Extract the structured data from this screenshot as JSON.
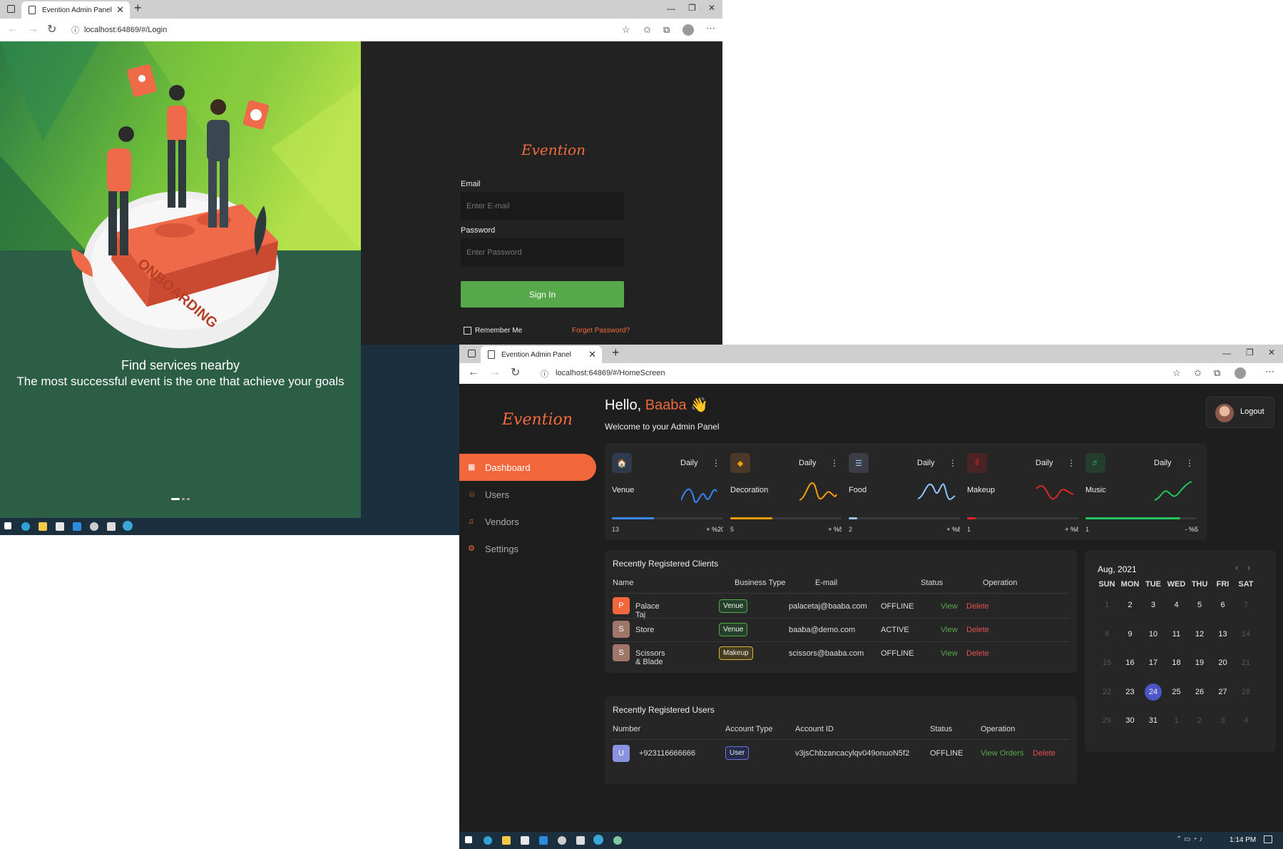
{
  "login_window": {
    "tab_title": "Evention Admin Panel",
    "url": "localhost:64869/#/Login",
    "illustration": {
      "headline": "Find services nearby",
      "subline": "The most successful event is the one that achieve your goals",
      "platform_text": "ONBOARDING"
    },
    "logo": "Evention",
    "email_label": "Email",
    "email_placeholder": "Enter E-mail",
    "password_label": "Password",
    "password_placeholder": "Enter Password",
    "signin_label": "Sign In",
    "remember_label": "Remember Me",
    "forgot_label": "Forget Password?"
  },
  "dashboard_window": {
    "tab_title": "Evention Admin Panel",
    "url": "localhost:64869/#/HomeScreen",
    "logo": "Evention",
    "greeting": "Hello,",
    "user_name": "Baaba",
    "wave": "👋",
    "welcome": "Welcome to your Admin Panel",
    "logout_label": "Logout",
    "sidebar": [
      {
        "label": "Dashboard",
        "icon": "grid-icon"
      },
      {
        "label": "Users",
        "icon": "user-icon"
      },
      {
        "label": "Vendors",
        "icon": "bell-icon"
      },
      {
        "label": "Settings",
        "icon": "gear-icon"
      }
    ],
    "cards": [
      {
        "name": "Venue",
        "period": "Daily",
        "count": "13",
        "change": "+ %20",
        "color": "#3a86ff",
        "progress": 0.38,
        "bg": "#2f3b4c"
      },
      {
        "name": "Decoration",
        "period": "Daily",
        "count": "5",
        "change": "+ %5",
        "color": "#f59e0b",
        "progress": 0.38,
        "bg": "#4a3828"
      },
      {
        "name": "Food",
        "period": "Daily",
        "count": "2",
        "change": "+ %8",
        "color": "#93c5fd",
        "progress": 0.08,
        "bg": "#3b3f45"
      },
      {
        "name": "Makeup",
        "period": "Daily",
        "count": "1",
        "change": "+ %8",
        "color": "#dc2626",
        "progress": 0.08,
        "bg": "#4a2424"
      },
      {
        "name": "Music",
        "period": "Daily",
        "count": "1",
        "change": "- %5",
        "color": "#22c55e",
        "progress": 0.85,
        "bg": "#243d2e"
      }
    ],
    "clients": {
      "title": "Recently Registered Clients",
      "headers": [
        "Name",
        "Business Type",
        "E-mail",
        "Status",
        "Operation"
      ],
      "rows": [
        {
          "initial": "P",
          "name": "Palace Taj",
          "type": "Venue",
          "email": "palacetaj@baaba.com",
          "status": "OFFLINE",
          "view": "View",
          "delete": "Delete",
          "avatar_color": "#f2683c",
          "badge_border": "#57a84a",
          "badge_bg": "#24402a"
        },
        {
          "initial": "S",
          "name": "Store",
          "type": "Venue",
          "email": "baaba@demo.com",
          "status": "ACTIVE",
          "view": "View",
          "delete": "Delete",
          "avatar_color": "#a0756a",
          "badge_border": "#57a84a",
          "badge_bg": "#24402a"
        },
        {
          "initial": "S",
          "name": "Scissors & Blade",
          "type": "Makeup",
          "email": "scissors@baaba.com",
          "status": "OFFLINE",
          "view": "View",
          "delete": "Delete",
          "avatar_color": "#a0756a",
          "badge_border": "#d4b44a",
          "badge_bg": "#463d1f"
        }
      ]
    },
    "users": {
      "title": "Recently Registered Users",
      "headers": [
        "Number",
        "Account Type",
        "Account ID",
        "Status",
        "Operation"
      ],
      "rows": [
        {
          "initial": "U",
          "number": "+923116666666",
          "type": "User",
          "account_id": "v3jsChbzancacylqv049onuoN5f2",
          "status": "OFFLINE",
          "view": "View Orders",
          "delete": "Delete"
        }
      ]
    },
    "calendar": {
      "month": "Aug, 2021",
      "days_of_week": [
        "SUN",
        "MON",
        "TUE",
        "WED",
        "THU",
        "FRI",
        "SAT"
      ],
      "weeks": [
        [
          "1",
          "2",
          "3",
          "4",
          "5",
          "6",
          "7"
        ],
        [
          "8",
          "9",
          "10",
          "11",
          "12",
          "13",
          "14"
        ],
        [
          "15",
          "16",
          "17",
          "18",
          "19",
          "20",
          "21"
        ],
        [
          "22",
          "23",
          "24",
          "25",
          "26",
          "27",
          "28"
        ],
        [
          "29",
          "30",
          "31",
          "1",
          "2",
          "3",
          "4"
        ]
      ],
      "today": "24"
    },
    "taskbar_time": "1:14 PM"
  }
}
